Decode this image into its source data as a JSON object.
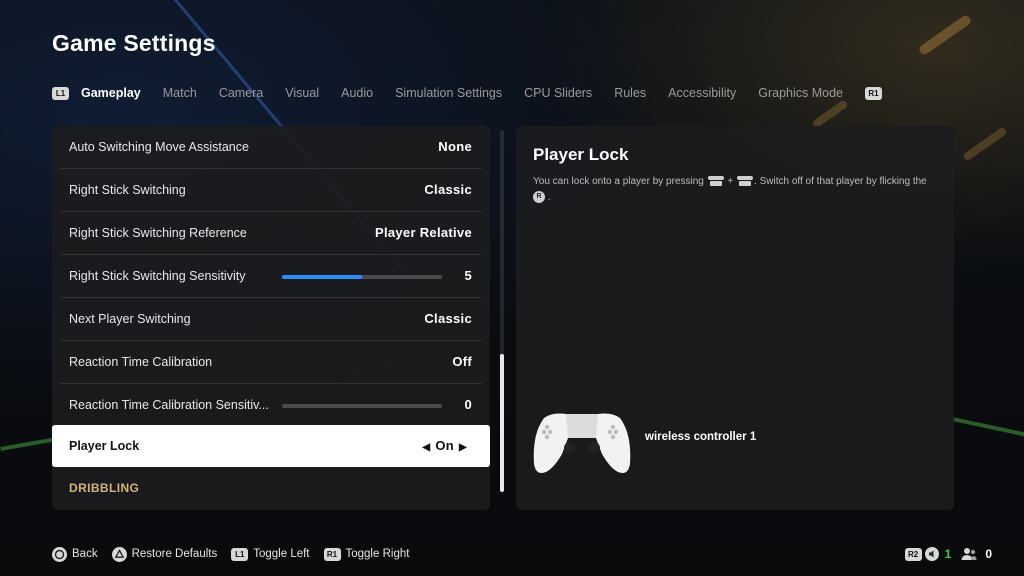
{
  "page": {
    "title": "Game Settings"
  },
  "tabs": {
    "left_button": "L1",
    "right_button": "R1",
    "items": [
      "Gameplay",
      "Match",
      "Camera",
      "Visual",
      "Audio",
      "Simulation Settings",
      "CPU Sliders",
      "Rules",
      "Accessibility",
      "Graphics Mode"
    ],
    "active": "Gameplay"
  },
  "settings": [
    {
      "label": "Auto Switching Move Assistance",
      "value": "None"
    },
    {
      "label": "Right Stick Switching",
      "value": "Classic"
    },
    {
      "label": "Right Stick Switching Reference",
      "value": "Player Relative"
    },
    {
      "label": "Right Stick Switching Sensitivity",
      "value": "5",
      "level": 0.5
    },
    {
      "label": "Next Player Switching",
      "value": "Classic"
    },
    {
      "label": "Reaction Time Calibration",
      "value": "Off"
    },
    {
      "label": "Reaction Time Calibration Sensitiv...",
      "value": "0",
      "level": 0
    },
    {
      "label": "Player Lock",
      "value": "On",
      "selected": true
    }
  ],
  "section_header": "DRIBBLING",
  "detail": {
    "title": "Player Lock",
    "desc_part1": "You can lock onto a player by pressing",
    "desc_plus": "+",
    "desc_part2": ". Switch off of that player by flicking the",
    "desc_end": ".",
    "stick_label": "R",
    "controller_name": "wireless controller 1"
  },
  "footer": {
    "items": [
      {
        "icon": "circle-button-icon",
        "label": "Back"
      },
      {
        "icon": "triangle-button-icon",
        "label": "Restore Defaults"
      },
      {
        "icon": "l1-button-icon",
        "btn": "L1",
        "label": "Toggle Left"
      },
      {
        "icon": "r1-button-icon",
        "btn": "R1",
        "label": "Toggle Right"
      }
    ]
  },
  "status": {
    "button": "R2",
    "controllers": "1",
    "players": "0",
    "accent": "#3ccf3c"
  },
  "colors": {
    "slider_fill": "#2f8cff",
    "section_header": "#d2b47a",
    "selected_bg": "#ffffff"
  }
}
